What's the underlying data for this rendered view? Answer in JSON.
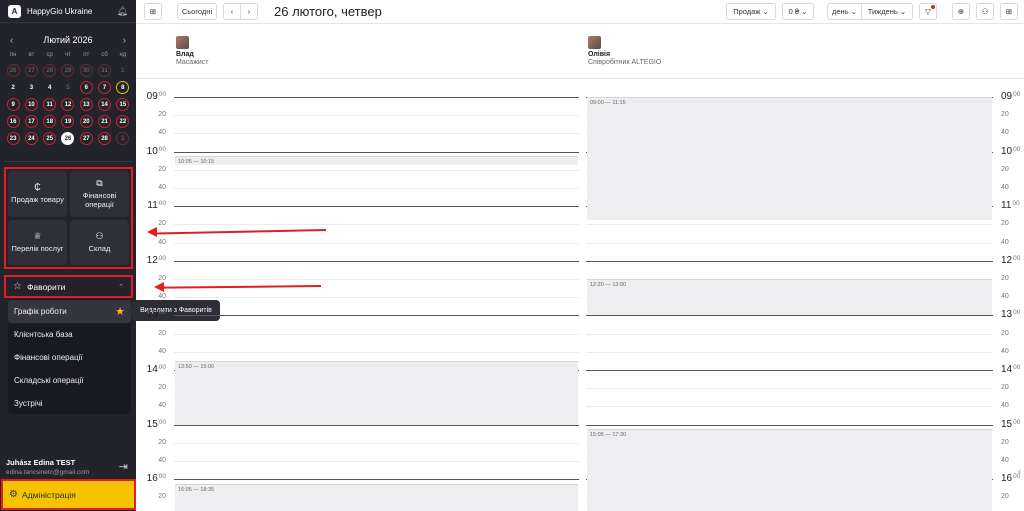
{
  "sidebar": {
    "company": "HappyGio Ukraine",
    "logo_letter": "A",
    "calendar": {
      "month_label": "Лютий 2026",
      "weekdays": [
        "пн",
        "вт",
        "ср",
        "чт",
        "пт",
        "сб",
        "нд"
      ],
      "days": [
        {
          "n": "26",
          "s": "muted"
        },
        {
          "n": "27",
          "s": "muted"
        },
        {
          "n": "28",
          "s": "muted"
        },
        {
          "n": "29",
          "s": "muted"
        },
        {
          "n": "30",
          "s": "muted"
        },
        {
          "n": "31",
          "s": "muted"
        },
        {
          "n": "1",
          "s": "plain muted"
        },
        {
          "n": "2",
          "s": "plain"
        },
        {
          "n": "3",
          "s": "plain"
        },
        {
          "n": "4",
          "s": "plain"
        },
        {
          "n": "5",
          "s": "plain muted"
        },
        {
          "n": "6",
          "s": ""
        },
        {
          "n": "7",
          "s": ""
        },
        {
          "n": "8",
          "s": "yellow"
        },
        {
          "n": "9",
          "s": ""
        },
        {
          "n": "10",
          "s": ""
        },
        {
          "n": "11",
          "s": ""
        },
        {
          "n": "12",
          "s": ""
        },
        {
          "n": "13",
          "s": ""
        },
        {
          "n": "14",
          "s": ""
        },
        {
          "n": "15",
          "s": ""
        },
        {
          "n": "16",
          "s": ""
        },
        {
          "n": "17",
          "s": ""
        },
        {
          "n": "18",
          "s": ""
        },
        {
          "n": "19",
          "s": ""
        },
        {
          "n": "20",
          "s": ""
        },
        {
          "n": "21",
          "s": ""
        },
        {
          "n": "22",
          "s": ""
        },
        {
          "n": "23",
          "s": ""
        },
        {
          "n": "24",
          "s": ""
        },
        {
          "n": "25",
          "s": ""
        },
        {
          "n": "26",
          "s": "today"
        },
        {
          "n": "27",
          "s": ""
        },
        {
          "n": "28",
          "s": ""
        },
        {
          "n": "1",
          "s": "muted"
        }
      ]
    },
    "quick_actions": [
      {
        "label": "Продаж товару",
        "icon": "₵",
        "name": "product-sale"
      },
      {
        "label": "Фінансові операції",
        "icon": "⧉",
        "name": "financial-operations"
      },
      {
        "label": "Перелік послуг",
        "icon": "♕",
        "name": "services-list"
      },
      {
        "label": "Склад",
        "icon": "⚇",
        "name": "warehouse"
      }
    ],
    "favorites": {
      "title": "Фаворити",
      "items": [
        "Графік роботи",
        "Клієнтська база",
        "Фінансові операції",
        "Складські операції",
        "Зустрічі"
      ],
      "tooltip": "Видалити з Фаворитів"
    },
    "user": {
      "name": "Juhász Edina TEST",
      "email": "edina.tancsinetc@gmail.com"
    },
    "admin_label": "Адміністрація"
  },
  "toolbar": {
    "today": "Сьогодні",
    "date_title": "26 лютого, четвер",
    "sales": "Продаж",
    "money": "0 ₴",
    "day": "день",
    "week": "Тиждень"
  },
  "staff": [
    {
      "name": "Влад",
      "role": "Масажист"
    },
    {
      "name": "Олівія",
      "role": "Співробітник ALTEGIO"
    }
  ],
  "timeline": {
    "hours": [
      "09",
      "10",
      "11",
      "12",
      "13",
      "14",
      "15",
      "16"
    ],
    "minute_marks": [
      "00",
      "20",
      "40"
    ]
  },
  "events": [
    {
      "col": 0,
      "start": "10:05",
      "end": "10:15",
      "label": "10:05 — 10:15"
    },
    {
      "col": 0,
      "start": "13:50",
      "end": "15:00",
      "label": "13:50 — 15:00"
    },
    {
      "col": 0,
      "start": "16:05",
      "end": "18:35",
      "label": "16:05 — 18:35"
    },
    {
      "col": 1,
      "start": "09:00",
      "end": "11:15",
      "label": "09:00 — 11:15"
    },
    {
      "col": 1,
      "start": "12:20",
      "end": "13:00",
      "label": "12:20 — 13:00"
    },
    {
      "col": 1,
      "start": "15:05",
      "end": "17:30",
      "label": "15:05 — 17:30"
    }
  ]
}
